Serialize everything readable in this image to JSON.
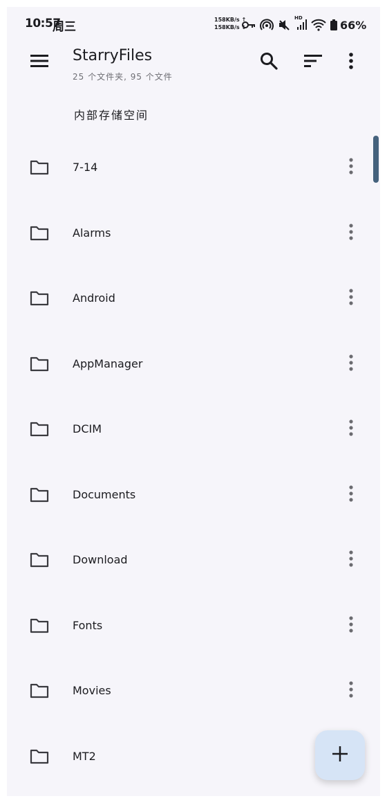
{
  "status_bar": {
    "time": "10:57",
    "day": "周三",
    "upload_speed": "158KB/s ↑",
    "download_speed": "158KB/s ↓",
    "network_label": "HD",
    "battery": "66%",
    "icons": [
      "key-icon",
      "hotspot-icon",
      "mute-icon",
      "signal-icon",
      "wifi-icon",
      "battery-icon"
    ]
  },
  "app_bar": {
    "title": "StarryFiles",
    "subtitle": "25 个文件夹, 95 个文件",
    "icons": [
      "menu-icon",
      "search-icon",
      "sort-icon",
      "more-vert-icon"
    ]
  },
  "breadcrumb": "内部存储空间",
  "files": [
    {
      "name": "7-14",
      "icon": "folder-icon"
    },
    {
      "name": "Alarms",
      "icon": "folder-icon"
    },
    {
      "name": "Android",
      "icon": "folder-icon"
    },
    {
      "name": "AppManager",
      "icon": "folder-icon"
    },
    {
      "name": "DCIM",
      "icon": "folder-icon"
    },
    {
      "name": "Documents",
      "icon": "folder-icon"
    },
    {
      "name": "Download",
      "icon": "folder-icon"
    },
    {
      "name": "Fonts",
      "icon": "folder-icon"
    },
    {
      "name": "Movies",
      "icon": "folder-icon"
    },
    {
      "name": "MT2",
      "icon": "folder-icon"
    }
  ],
  "fab": {
    "icon": "add-icon"
  },
  "colors": {
    "background": "#f6f5fa",
    "text": "#1b1b1f",
    "subtitle": "#6d6d73",
    "scrollbar": "#45627d",
    "fab": "#d6e4f6"
  }
}
